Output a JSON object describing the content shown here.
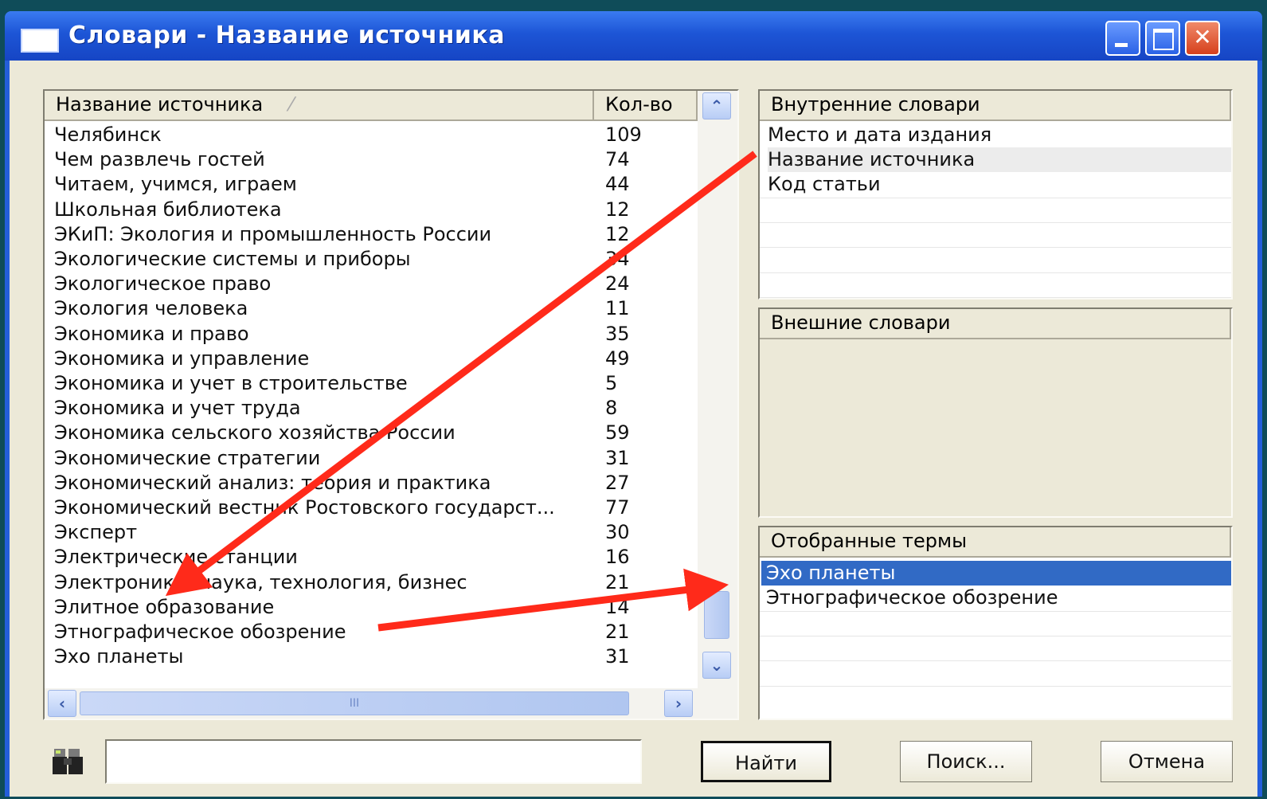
{
  "window": {
    "title": "Словари - Название источника"
  },
  "source_list": {
    "header_name": "Название источника",
    "header_count": "Кол-во",
    "rows": [
      {
        "name": "Челябинск",
        "count": "109"
      },
      {
        "name": "Чем развлечь гостей",
        "count": "74"
      },
      {
        "name": "Читаем, учимся, играем",
        "count": "44"
      },
      {
        "name": "Школьная библиотека",
        "count": "12"
      },
      {
        "name": "ЭКиП: Экология и промышленность России",
        "count": "12"
      },
      {
        "name": "Экологические системы и приборы",
        "count": "34"
      },
      {
        "name": "Экологическое право",
        "count": "24"
      },
      {
        "name": "Экология человека",
        "count": "11"
      },
      {
        "name": "Экономика и право",
        "count": "35"
      },
      {
        "name": "Экономика и управление",
        "count": "49"
      },
      {
        "name": "Экономика и учет в строительстве",
        "count": "5"
      },
      {
        "name": "Экономика и учет труда",
        "count": "8"
      },
      {
        "name": "Экономика сельского хозяйства России",
        "count": "59"
      },
      {
        "name": "Экономические стратегии",
        "count": "31"
      },
      {
        "name": "Экономический анализ: теория и практика",
        "count": "27"
      },
      {
        "name": "Экономический вестник Ростовского государст...",
        "count": "77"
      },
      {
        "name": "Эксперт",
        "count": "30"
      },
      {
        "name": "Электрические станции",
        "count": "16"
      },
      {
        "name": "Электроника: наука, технология, бизнес",
        "count": "21"
      },
      {
        "name": "Элитное образование",
        "count": "14"
      },
      {
        "name": "Этнографическое обозрение",
        "count": "21"
      },
      {
        "name": "Эхо планеты",
        "count": "31"
      }
    ],
    "hscroll_grip": "III"
  },
  "internal_dicts": {
    "header": "Внутренние словари",
    "items": [
      "Место и дата издания",
      "Название источника",
      "Код статьи"
    ],
    "highlighted_index": 1
  },
  "external_dicts": {
    "header": "Внешние словари"
  },
  "selected_terms": {
    "header": "Отобранные термы",
    "items": [
      "Эхо планеты",
      "Этнографическое обозрение"
    ],
    "selected_index": 0
  },
  "search": {
    "value": ""
  },
  "buttons": {
    "find": "Найти",
    "search": "Поиск...",
    "cancel": "Отмена"
  },
  "colors": {
    "selection": "#316ac5",
    "annotation_arrow": "#ff2a1a",
    "titlebar": "#1d55d6"
  }
}
